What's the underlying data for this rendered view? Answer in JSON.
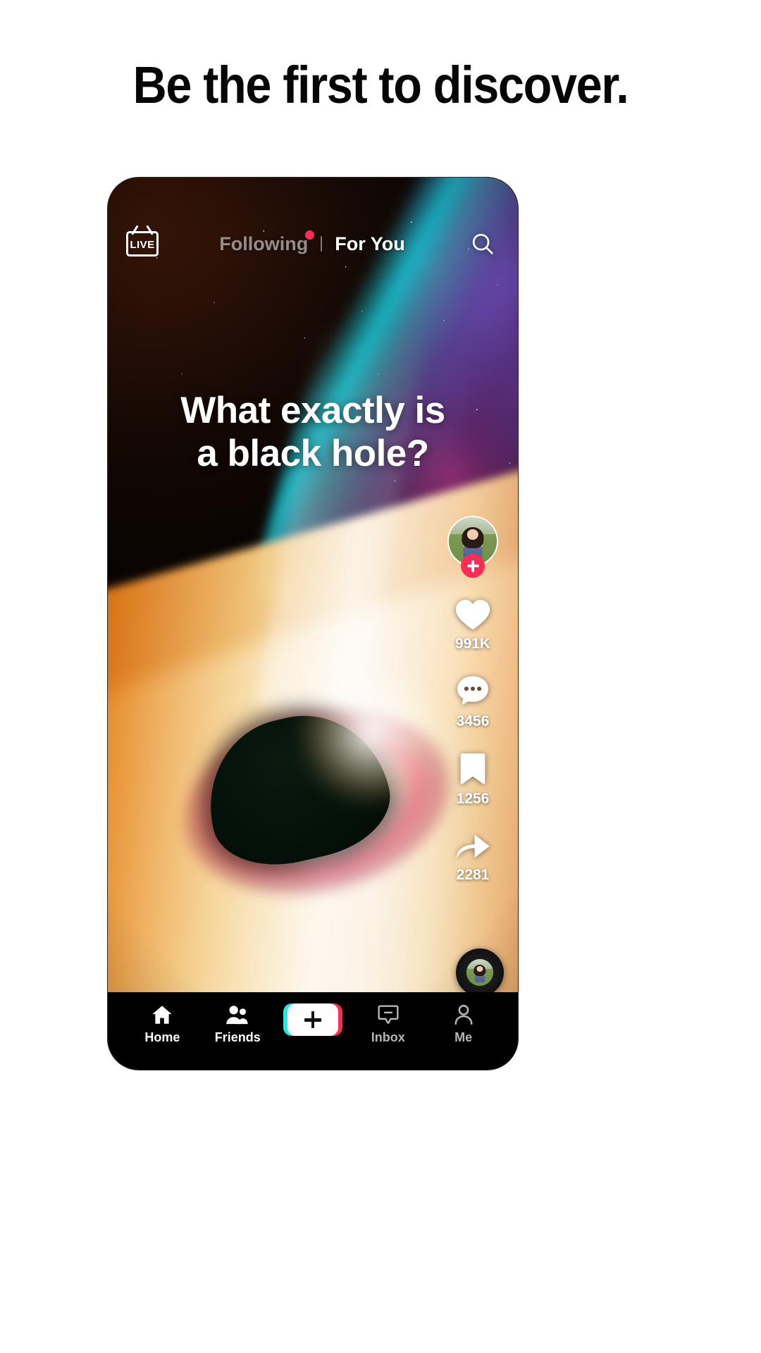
{
  "headline": "Be the first to discover.",
  "phone": {
    "topnav": {
      "live_label": "LIVE",
      "tabs": [
        {
          "label": "Following",
          "active": false,
          "has_badge": true
        },
        {
          "label": "For You",
          "active": true,
          "has_badge": false
        }
      ],
      "search_icon": "search-icon"
    },
    "video": {
      "caption_line1": "What exactly is",
      "caption_line2": "a black hole?",
      "background": "black-hole-space-nebula"
    },
    "rail": {
      "avatar_icon": "user-avatar",
      "follow_icon": "plus-icon",
      "actions": [
        {
          "icon": "heart-icon",
          "count": "991K",
          "name": "like"
        },
        {
          "icon": "comment-icon",
          "count": "3456",
          "name": "comment"
        },
        {
          "icon": "bookmark-icon",
          "count": "1256",
          "name": "bookmark"
        },
        {
          "icon": "share-icon",
          "count": "2281",
          "name": "share"
        }
      ],
      "music_disc_icon": "music-disc",
      "music_notes_icon": "music-notes-icon"
    },
    "bottomnav": [
      {
        "label": "Home",
        "icon": "home-icon",
        "active": true
      },
      {
        "label": "Friends",
        "icon": "friends-icon",
        "active": true
      },
      {
        "label": "",
        "icon": "create-plus-button",
        "active": false
      },
      {
        "label": "Inbox",
        "icon": "inbox-icon",
        "active": false
      },
      {
        "label": "Me",
        "icon": "profile-icon",
        "active": false
      }
    ]
  },
  "colors": {
    "accent_pink": "#fe2c55",
    "accent_cyan": "#29e6e6",
    "text_white": "#ffffff",
    "nav_dim": "#b6b4b4",
    "page_bg": "#ffffff",
    "phone_bg": "#000000"
  }
}
